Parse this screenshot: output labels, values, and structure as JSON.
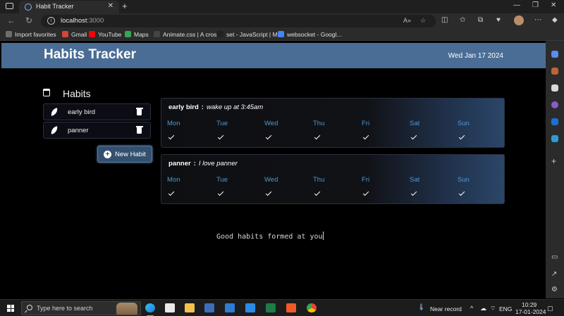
{
  "browser": {
    "tab_title": "Habit Tracker",
    "url_host": "localhost",
    "url_port": ":3000",
    "bookmarks": [
      {
        "label": "Import favorites",
        "color": "#6d6d6d"
      },
      {
        "label": "Gmail",
        "color": "#d44638"
      },
      {
        "label": "YouTube",
        "color": "#ff0000"
      },
      {
        "label": "Maps",
        "color": "#34a853"
      },
      {
        "label": "Animate.css | A cros...",
        "color": "#444444"
      },
      {
        "label": "set - JavaScript | M...",
        "color": "#222222"
      },
      {
        "label": "websocket - Googl...",
        "color": "#4285f4"
      }
    ]
  },
  "app": {
    "title": "Habits Tracker",
    "date": "Wed Jan 17 2024",
    "habits_heading": "Habits",
    "new_habit_label": "New Habit",
    "habits": [
      {
        "name": "early bird"
      },
      {
        "name": "panner"
      }
    ],
    "cards": [
      {
        "name": "early bird",
        "description": "wake up at 3:45am",
        "days": [
          "Mon",
          "Tue",
          "Wed",
          "Thu",
          "Fri",
          "Sat",
          "Sun"
        ]
      },
      {
        "name": "panner",
        "description": "I love panner",
        "days": [
          "Mon",
          "Tue",
          "Wed",
          "Thu",
          "Fri",
          "Sat",
          "Sun"
        ]
      }
    ],
    "typing_text": "Good habits formed at you"
  },
  "taskbar": {
    "search_placeholder": "Type here to search",
    "weather": "Near record",
    "lang": "ENG",
    "time": "10:29",
    "date": "17-01-2024"
  },
  "colors": {
    "header_bg": "#4a6d95",
    "day_label": "#4a9ad8",
    "button_bg": "#34506f"
  }
}
